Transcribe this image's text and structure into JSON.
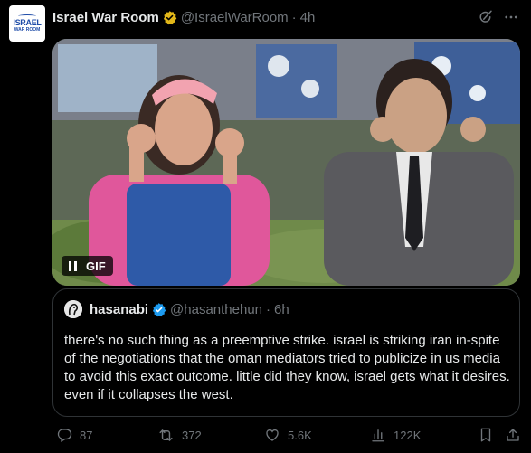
{
  "tweet": {
    "avatar": {
      "line1": "ISRAEL",
      "line2": "WAR ROOM"
    },
    "author_name": "Israel War Room",
    "handle": "@IsraelWarRoom",
    "separator": "·",
    "time": "4h",
    "verified_badge_color": "#e2b719",
    "media": {
      "type": "gif",
      "gif_label": "GIF",
      "paused": true
    }
  },
  "quote": {
    "author_name": "hasanabi",
    "handle": "@hasanthehun",
    "separator": "·",
    "time": "6h",
    "verified_badge_color": "#1d9bf0",
    "text": "there's no such thing as a preemptive strike. israel is striking iran in-spite of the negotiations that the oman mediators tried to publicize in us media to avoid this exact outcome. little did they know, israel gets what it desires. even if it collapses the west."
  },
  "actions": {
    "replies": "87",
    "reposts": "372",
    "likes": "5.6K",
    "views": "122K"
  },
  "icons": {
    "header": [
      "grok-icon",
      "more-icon"
    ],
    "actions": [
      "reply-icon",
      "repost-icon",
      "like-icon",
      "views-icon",
      "bookmark-icon",
      "share-icon"
    ]
  },
  "colors": {
    "background": "#000000",
    "text": "#e7e9ea",
    "muted": "#71767b",
    "border": "#2f3336"
  }
}
